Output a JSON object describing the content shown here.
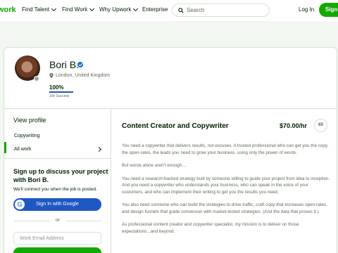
{
  "header": {
    "logo": "work",
    "nav": [
      {
        "label": "Find Talent",
        "has_chevron": true
      },
      {
        "label": "Find Work",
        "has_chevron": true
      },
      {
        "label": "Why Upwork",
        "has_chevron": true
      },
      {
        "label": "Enterprise",
        "has_chevron": false
      }
    ],
    "search_placeholder": "Search",
    "login_label": "Log In",
    "signup_label": "Sign"
  },
  "profile": {
    "name": "Bori B.",
    "location": "London, United Kingdom",
    "job_success_value": "100%",
    "job_success_fraction": 1.0,
    "job_success_label": "Job Success"
  },
  "sidebar": {
    "view_profile": "View profile",
    "items": [
      {
        "label": "Copywriting",
        "active": false
      },
      {
        "label": "All work",
        "active": true
      }
    ],
    "signup_title": "Sign up to discuss your project with Bori B.",
    "signup_sub": "We'll connect you when the job is posted.",
    "google_button": "Sign In with Google",
    "or_label": "or",
    "email_placeholder": "Work Email Address"
  },
  "main": {
    "job_title": "Content Creator and Copywriter",
    "rate": "$70.00/hr",
    "share_label": "69",
    "paragraphs": [
      "You need a copywriter that delivers results, not excuses. A trusted professional who can get you the copy, the open-rates, the leads you need to grow your business, using only the power of words.",
      "But words alone aren't enough…",
      "You need a research-backed strategy built by someone willing to guide your project from idea to inception. And you need a copywriter who understands your business, who can speak in the voice of your customers, and who can implement their writing to get you the results you need.",
      "You also need someone who can build the strategies to drive traffic, craft copy that increases open-rates, and design funnels that guide conversion with market-tested strategies. (And the data that proves it.)",
      "As professional content creator and copywriter specialist, my mission is to deliver on those expectations...and beyond."
    ]
  },
  "colors": {
    "brand_green": "#14a800",
    "primary_blue": "#1f57c3",
    "verified_blue": "#0c6ee0",
    "text_dark": "#001e00",
    "text_muted": "#5e6d55"
  },
  "icons": [
    "search-icon",
    "verified-badge-icon",
    "location-pin-icon",
    "chevron-down-icon",
    "chevron-right-icon",
    "google-icon",
    "share-icon"
  ]
}
